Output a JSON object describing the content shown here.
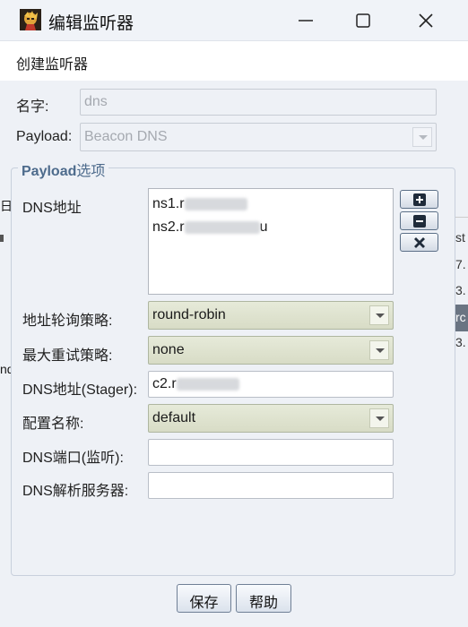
{
  "window": {
    "title": "编辑监听器"
  },
  "dialog": {
    "header": "创建监听器"
  },
  "name": {
    "label": "名字:",
    "value": "dns"
  },
  "payload": {
    "label": "Payload:",
    "value": "Beacon DNS"
  },
  "options": {
    "title_bold": "Payload",
    "title_rest": "选项",
    "dns_hosts_label": "DNS地址",
    "dns_hosts": [
      "ns1.r",
      "ns2.r"
    ],
    "dns_hosts_tail": [
      "",
      "u"
    ],
    "host_rotation_label": "地址轮询策略:",
    "host_rotation_value": "round-robin",
    "max_retry_label": "最大重试策略:",
    "max_retry_value": "none",
    "stager_label": "DNS地址(Stager):",
    "stager_value": "c2.r",
    "profile_label": "配置名称:",
    "profile_value": "default",
    "port_label": "DNS端口(监听):",
    "port_value": "",
    "resolver_label": "DNS解析服务器:",
    "resolver_value": ""
  },
  "buttons": {
    "save": "保存",
    "help": "帮助"
  },
  "background": {
    "right_fragments": [
      "st",
      "7.",
      "3.",
      "rc",
      "3."
    ],
    "left_fragments": [
      "日",
      "nd"
    ]
  },
  "colors": {
    "group_title": "#4d6b8c",
    "combo_bg": "#dfe3cf",
    "body_bg": "#eef1f6"
  }
}
